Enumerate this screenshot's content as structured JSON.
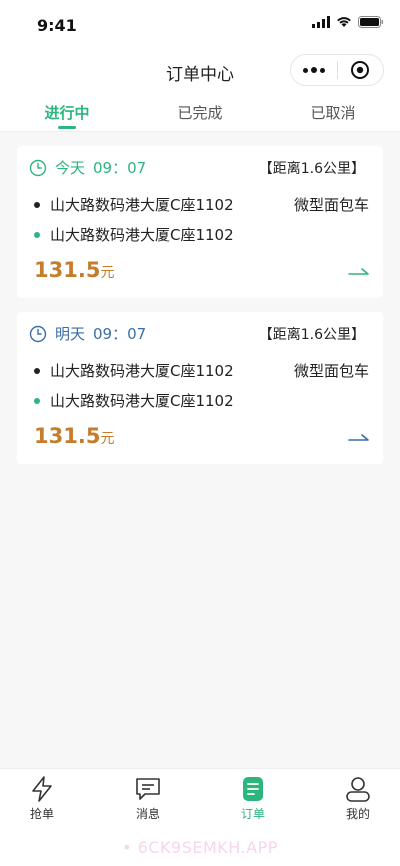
{
  "status_bar": {
    "time": "9:41"
  },
  "nav": {
    "title": "订单中心"
  },
  "tabs": [
    {
      "label": "进行中",
      "active": true
    },
    {
      "label": "已完成",
      "active": false
    },
    {
      "label": "已取消",
      "active": false
    }
  ],
  "orders": [
    {
      "day": "今天",
      "time": "09：07",
      "distance": "【距离1.6公里】",
      "from": "山大路数码港大厦C座1102",
      "to": "山大路数码港大厦C座1102",
      "vehicle": "微型面包车",
      "price": "131.5",
      "unit": "元",
      "accent": "#2db57e"
    },
    {
      "day": "明天",
      "time": "09：07",
      "distance": "【距离1.6公里】",
      "from": "山大路数码港大厦C座1102",
      "to": "山大路数码港大厦C座1102",
      "vehicle": "微型面包车",
      "price": "131.5",
      "unit": "元",
      "accent": "#3a6ea8"
    }
  ],
  "bottom_nav": [
    {
      "label": "抢单",
      "icon": "lightning-icon",
      "active": false
    },
    {
      "label": "消息",
      "icon": "message-icon",
      "active": false
    },
    {
      "label": "订单",
      "icon": "order-icon",
      "active": true
    },
    {
      "label": "我的",
      "icon": "profile-icon",
      "active": false
    }
  ],
  "watermark": "• 6CK9SEMKH.APP",
  "colors": {
    "primary": "#2db57e",
    "price": "#c57d2c",
    "secondary_accent": "#3a6ea8"
  }
}
